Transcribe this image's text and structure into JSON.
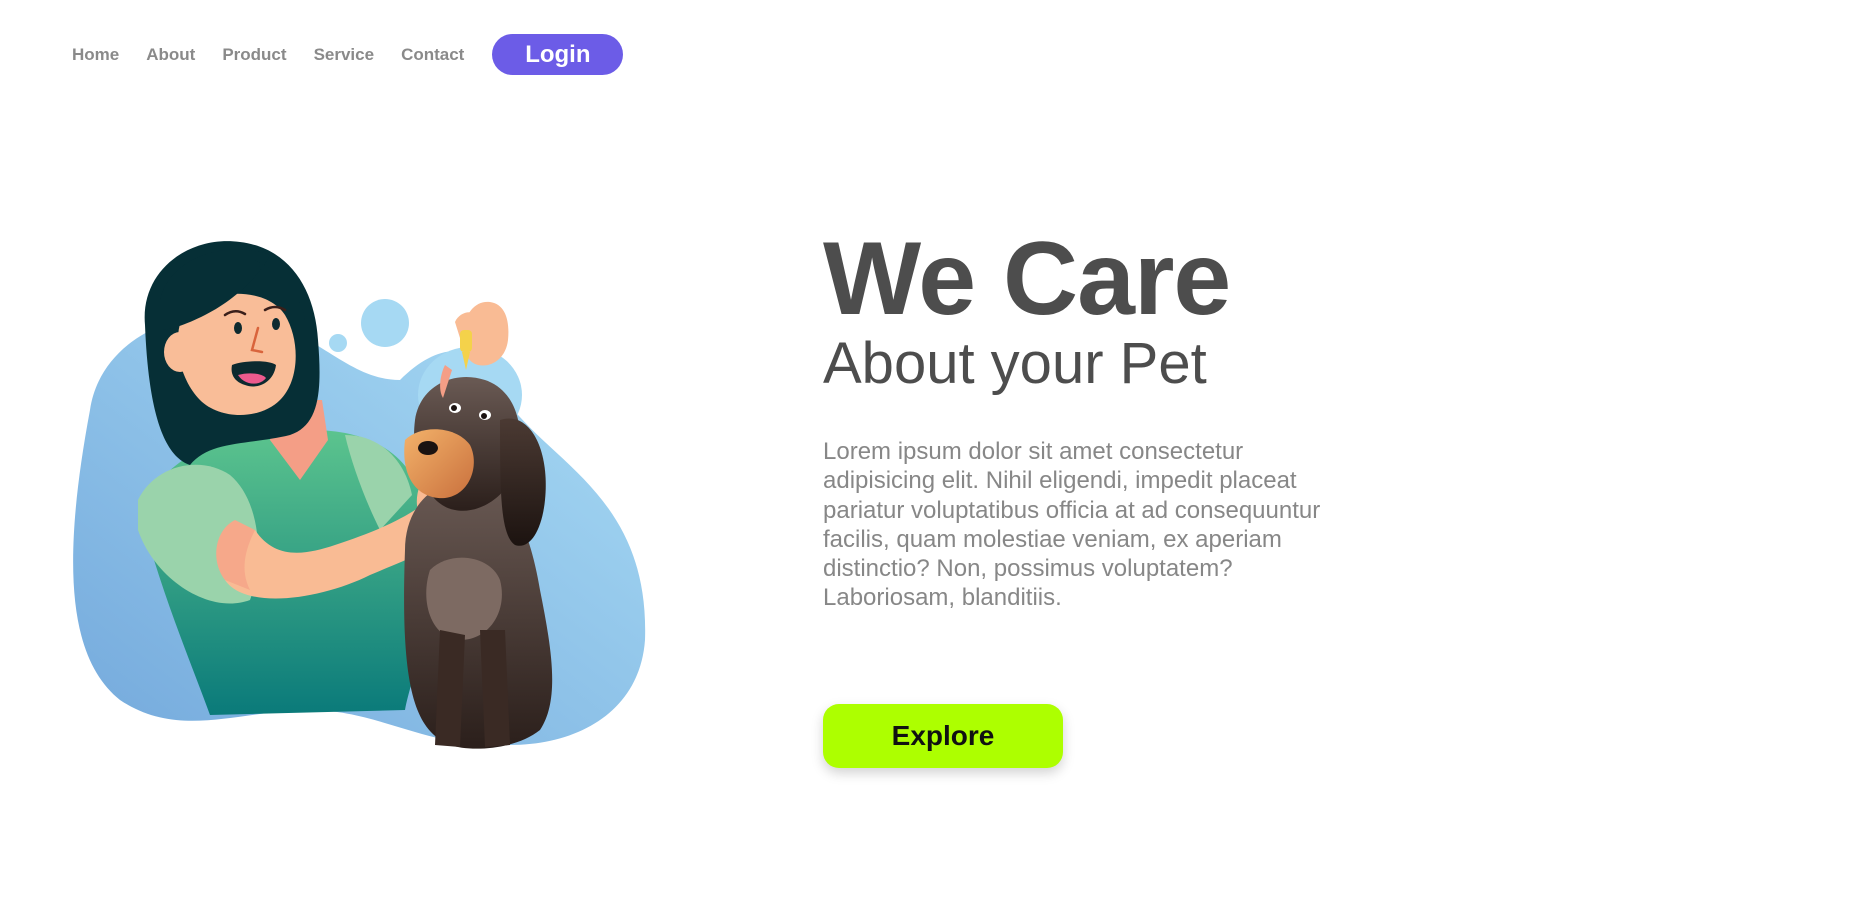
{
  "nav": {
    "items": [
      {
        "label": "Home"
      },
      {
        "label": "About"
      },
      {
        "label": "Product"
      },
      {
        "label": "Service"
      },
      {
        "label": "Contact"
      }
    ],
    "login_label": "Login"
  },
  "hero": {
    "headline": "We Care",
    "subheadline": "About your Pet",
    "body": "Lorem ipsum dolor sit amet consectetur adipisicing elit. Nihil eligendi, impedit placeat pariatur voluptatibus officia at ad consequuntur facilis, quam molestiae veniam, ex aperiam distinctio? Non, possimus voluptatem? Laboriosam, blanditiis.",
    "cta_label": "Explore"
  },
  "colors": {
    "login_bg": "#6c5ce7",
    "explore_bg": "#adff00",
    "heading_text": "#4d4d4d",
    "body_text": "#878787",
    "nav_text": "#8a8a8a"
  },
  "illustration": {
    "subject": "woman-giving-dog-ear-drops"
  }
}
